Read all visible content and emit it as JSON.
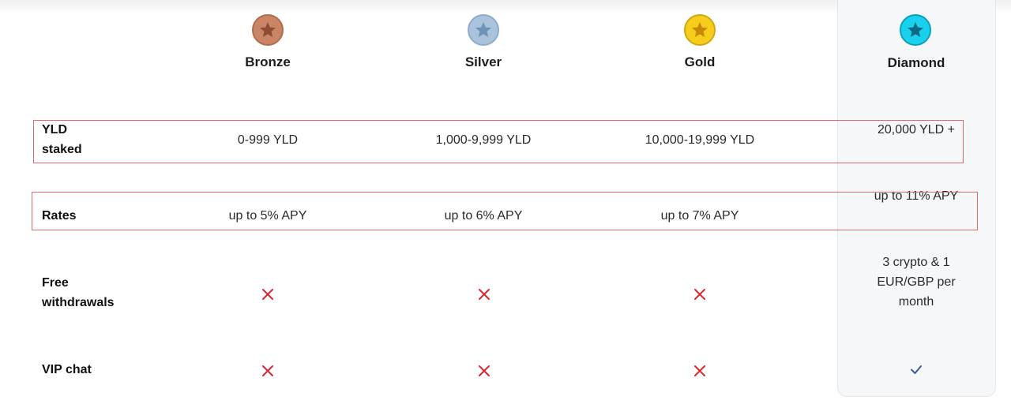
{
  "tiers": [
    {
      "name": "Bronze",
      "medal_icon": "bronze-star-medal-icon",
      "color": "#c98566"
    },
    {
      "name": "Silver",
      "medal_icon": "silver-star-medal-icon",
      "color": "#a9c3dc"
    },
    {
      "name": "Gold",
      "medal_icon": "gold-star-medal-icon",
      "color": "#f7cd1d"
    },
    {
      "name": "Diamond",
      "medal_icon": "diamond-star-medal-icon",
      "color": "#19d1ec",
      "highlighted": true
    }
  ],
  "rows": {
    "yld_staked": {
      "label_line1": "YLD",
      "label_line2": "staked",
      "values": [
        "0-999 YLD",
        "1,000-9,999 YLD",
        "10,000-19,999 YLD",
        "20,000 YLD +"
      ]
    },
    "rates": {
      "label": "Rates",
      "values": [
        "up to 5% APY",
        "up to 6% APY",
        "up to 7% APY",
        "up to 11% APY"
      ]
    },
    "free_withdrawals": {
      "label_line1": "Free",
      "label_line2": "withdrawals",
      "marks": [
        "cross-icon",
        "cross-icon",
        "cross-icon"
      ],
      "diamond_line1": "3 crypto & 1",
      "diamond_line2": "EUR/GBP per",
      "diamond_line3": "month"
    },
    "vip_chat": {
      "label": "VIP chat",
      "marks": [
        "cross-icon",
        "cross-icon",
        "cross-icon",
        "checkmark-icon"
      ]
    }
  },
  "colors": {
    "cross": "#d8252f",
    "check": "#3b5ba5",
    "highlight_box": "#e06a6a",
    "diamond_panel": "#f6f7f9"
  }
}
